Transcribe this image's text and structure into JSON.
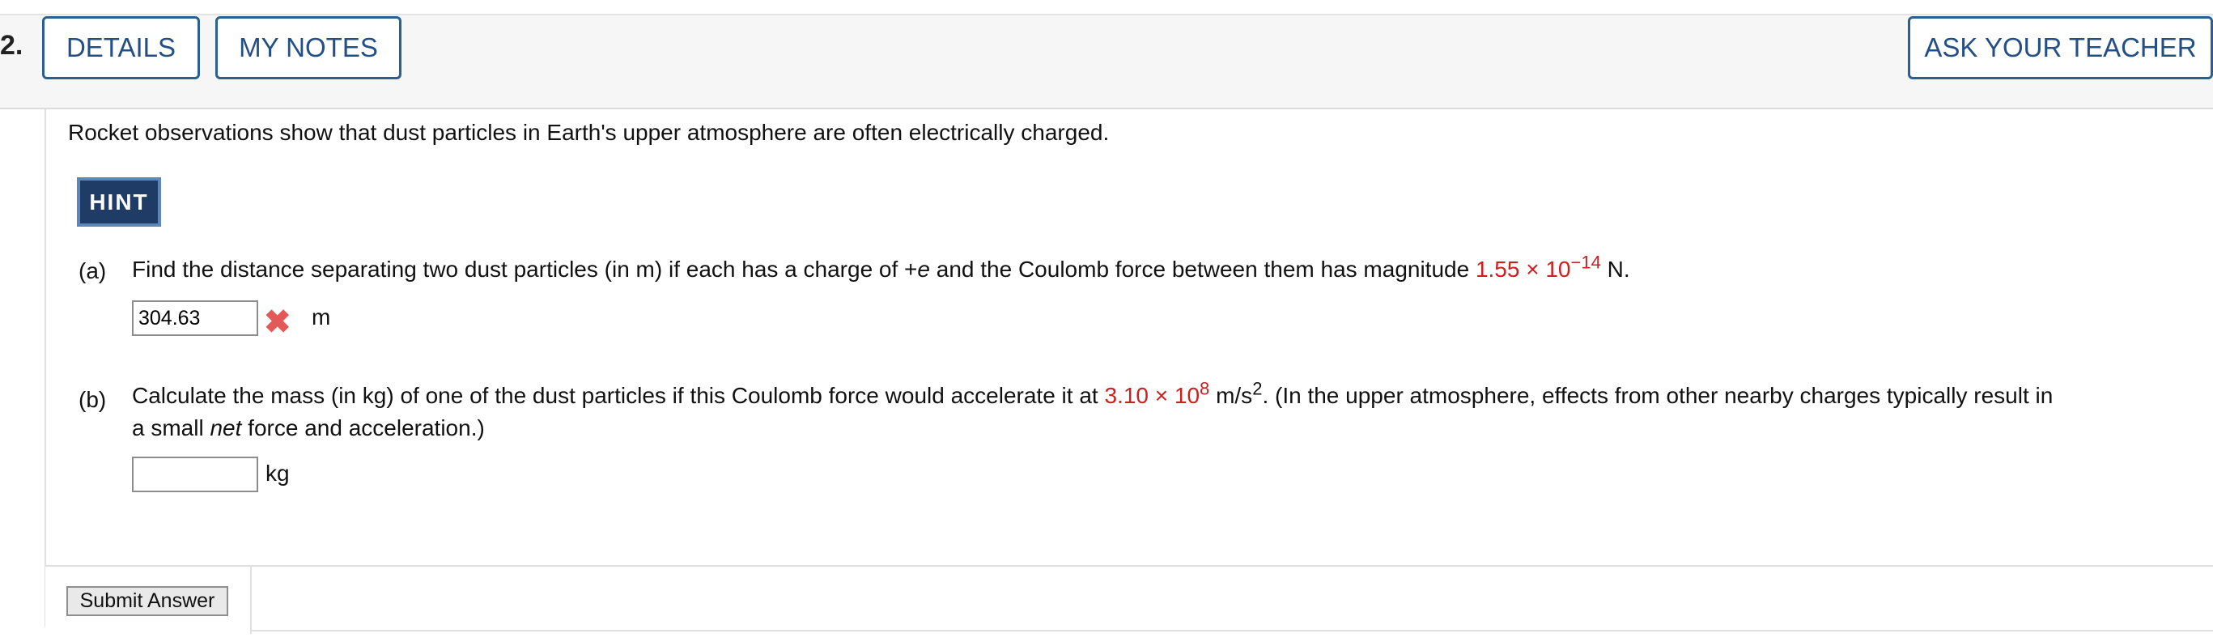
{
  "header": {
    "question_number": "2.",
    "details_label": "DETAILS",
    "notes_label": "MY NOTES",
    "ask_label": "ASK YOUR TEACHER"
  },
  "intro": "Rocket observations show that dust particles in Earth's upper atmosphere are often electrically charged.",
  "hint_label": "HINT",
  "part_a": {
    "label": "(a)",
    "text_before": "Find the distance separating two dust particles (in m) if each has a charge of +",
    "charge_symbol": "e",
    "text_middle": " and the Coulomb force between them has magnitude ",
    "value_mantissa": "1.55 × 10",
    "value_exponent": "−14",
    "text_after": " N.",
    "answer_value": "304.63",
    "status": "incorrect",
    "unit": "m"
  },
  "part_b": {
    "label": "(b)",
    "text_before": "Calculate the mass (in kg) of one of the dust particles if this Coulomb force would accelerate it at ",
    "value_mantissa": "3.10 × 10",
    "value_exponent": "8",
    "text_unit": " m/s",
    "unit_exponent": "2",
    "text_after": ". (In the upper atmosphere, effects from other nearby charges typically result in",
    "line2_before": "a small ",
    "line2_italic": "net",
    "line2_after": " force and acceleration.)",
    "answer_value": "",
    "unit": "kg"
  },
  "submit_label": "Submit Answer",
  "colors": {
    "accent_blue": "#234f85",
    "hint_bg": "#1f3c66",
    "given_value_red": "#cc1f1f",
    "incorrect_mark": "#e45858"
  }
}
